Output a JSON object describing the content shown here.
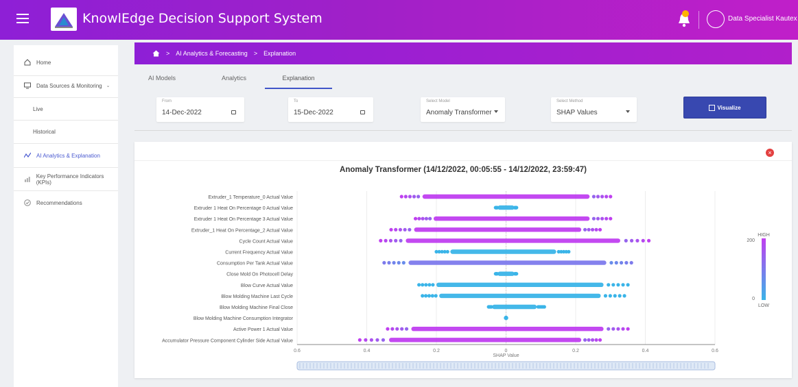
{
  "header": {
    "title": "KnowlEdge Decision Support System",
    "user": "Data Specialist Kautex"
  },
  "sidebar": {
    "items": [
      {
        "label": "Home"
      },
      {
        "label": "Data Sources & Monitoring"
      },
      {
        "label": "Live"
      },
      {
        "label": "Historical"
      },
      {
        "label": "AI Analytics & Explanation"
      },
      {
        "label": "Key Performance Indicators (KPIs)"
      },
      {
        "label": "Recommendations"
      }
    ]
  },
  "breadcrumb": {
    "sep": ">",
    "path1": "AI Analytics & Forecasting",
    "path2": "Explanation"
  },
  "tabs": [
    {
      "label": "AI Models"
    },
    {
      "label": "Analytics"
    },
    {
      "label": "Explanation"
    }
  ],
  "filters": {
    "from": {
      "label": "From",
      "value": "14-Dec-2022"
    },
    "to": {
      "label": "To",
      "value": "15-Dec-2022"
    },
    "model": {
      "label": "Select Model",
      "value": "Anomaly Transformer"
    },
    "method": {
      "label": "Select Method",
      "value": "SHAP Values"
    },
    "visualize": "Visualize"
  },
  "colors": {
    "accent": "#3848b0",
    "low": "#3ab4e8",
    "high": "#c03ff0"
  },
  "chart_data": {
    "type": "scatter",
    "title": "Anomaly Transformer (14/12/2022, 00:05:55 - 14/12/2022, 23:59:47)",
    "xlabel": "SHAP Value",
    "xlim": [
      -0.6,
      0.6
    ],
    "xticks": [
      "0.6",
      "0.4",
      "0.2",
      "0",
      "0.2",
      "0.4",
      "0.6"
    ],
    "colorbar": {
      "high_label": "HIGH",
      "low_label": "LOW",
      "max": "200",
      "min": "0"
    },
    "features": [
      {
        "name": "Extruder_1 Temperature_0 Actual Value",
        "min": -0.3,
        "max": 0.3,
        "c": 1
      },
      {
        "name": "Extruder 1 Heat On Percentage 0 Actual Value",
        "min": -0.03,
        "max": 0.03,
        "c": 0
      },
      {
        "name": "Extruder 1 Heat On Percentage 3 Actual Value",
        "min": -0.26,
        "max": 0.3,
        "c": 1
      },
      {
        "name": "Extruder_1 Heat On Percentage_2 Actual Value",
        "min": -0.33,
        "max": 0.27,
        "c": 1
      },
      {
        "name": "Cycle Count Actual Value",
        "min": -0.36,
        "max": 0.41,
        "c": 1
      },
      {
        "name": "Current Frequency Actual Value",
        "min": -0.2,
        "max": 0.18,
        "c": 0
      },
      {
        "name": "Consumption Per Tank Actual Value",
        "min": -0.35,
        "max": 0.36,
        "c": 0.5
      },
      {
        "name": "Close Mold On Photocell Delay",
        "min": -0.03,
        "max": 0.03,
        "c": 0
      },
      {
        "name": "Blow Curve Actual Value",
        "min": -0.25,
        "max": 0.35,
        "c": 0
      },
      {
        "name": "Blow Molding Machine Last Cycle",
        "min": -0.24,
        "max": 0.34,
        "c": 0
      },
      {
        "name": "Blow Molding Machine Final Close",
        "min": -0.05,
        "max": 0.11,
        "c": 0
      },
      {
        "name": "Blow Molding Machine Consumption Integrator",
        "min": 0,
        "max": 0,
        "c": 0
      },
      {
        "name": "Active Power 1 Actual Value",
        "min": -0.34,
        "max": 0.35,
        "c": 1
      },
      {
        "name": "Accumulator Pressure Component Cylinder Side Actual Value",
        "min": -0.42,
        "max": 0.27,
        "c": 1
      }
    ]
  }
}
